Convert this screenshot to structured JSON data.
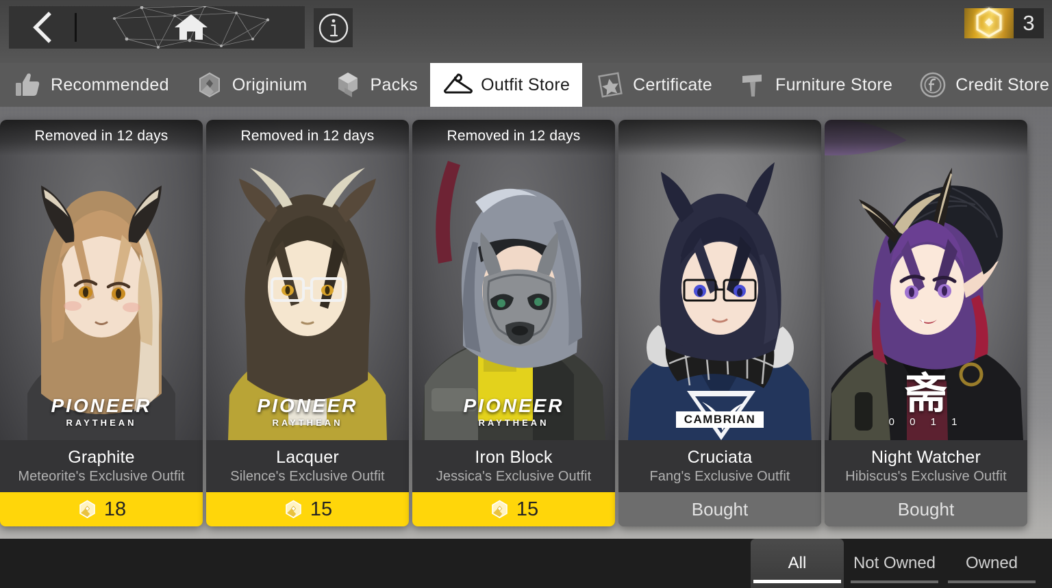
{
  "header": {
    "back_icon": "chevron-left-icon",
    "home_icon": "home-icon",
    "info_icon": "info-icon",
    "currency": {
      "icon": "originium-prime-icon",
      "amount": "3"
    }
  },
  "tabs": [
    {
      "label": "Recommended",
      "icon": "thumbs-up-icon",
      "active": false
    },
    {
      "label": "Originium",
      "icon": "originium-icon",
      "active": false
    },
    {
      "label": "Packs",
      "icon": "packs-icon",
      "active": false
    },
    {
      "label": "Outfit Store",
      "icon": "hanger-icon",
      "active": true
    },
    {
      "label": "Certificate",
      "icon": "certificate-icon",
      "active": false
    },
    {
      "label": "Furniture Store",
      "icon": "hammer-icon",
      "active": false
    },
    {
      "label": "Credit Store",
      "icon": "credit-coin-icon",
      "active": false
    }
  ],
  "cards": [
    {
      "ribbon": "Removed in 12 days",
      "name": "Graphite",
      "owner": "Meteorite's Exclusive Outfit",
      "state": "price",
      "price": "18",
      "price_icon": "originium-prime-icon",
      "brand_type": "pioneer",
      "brand_main": "PIONEER",
      "brand_sub": "RAYTHEAN",
      "art": "meteorite-portrait"
    },
    {
      "ribbon": "Removed in 12 days",
      "name": "Lacquer",
      "owner": "Silence's Exclusive Outfit",
      "state": "price",
      "price": "15",
      "price_icon": "originium-prime-icon",
      "brand_type": "pioneer",
      "brand_main": "PIONEER",
      "brand_sub": "RAYTHEAN",
      "art": "silence-portrait"
    },
    {
      "ribbon": "Removed in 12 days",
      "name": "Iron Block",
      "owner": "Jessica's Exclusive Outfit",
      "state": "price",
      "price": "15",
      "price_icon": "originium-prime-icon",
      "brand_type": "pioneer",
      "brand_main": "PIONEER",
      "brand_sub": "RAYTHEAN",
      "art": "jessica-portrait"
    },
    {
      "ribbon": "",
      "name": "Cruciata",
      "owner": "Fang's Exclusive Outfit",
      "state": "bought",
      "bought_label": "Bought",
      "brand_type": "cambrian",
      "brand_main": "CAMBRIAN",
      "brand_sub": "",
      "art": "fang-portrait"
    },
    {
      "ribbon": "",
      "name": "Night Watcher",
      "owner": "Hibiscus's Exclusive Outfit",
      "state": "bought",
      "bought_label": "Bought",
      "brand_type": "cn",
      "brand_main": "斋",
      "brand_sub": "0 0 1 1",
      "art": "hibiscus-portrait"
    }
  ],
  "filters": [
    {
      "label": "All",
      "active": true
    },
    {
      "label": "Not Owned",
      "active": false
    },
    {
      "label": "Owned",
      "active": false
    }
  ]
}
